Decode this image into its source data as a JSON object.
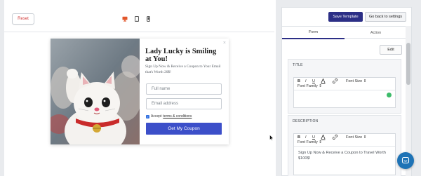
{
  "toolbar": {
    "reset_label": "Reset",
    "device_icons": [
      "desktop-icon",
      "tablet-icon",
      "mobile-icon"
    ]
  },
  "popup": {
    "title": "Lady Lucky is Smiling at You!",
    "description": "Sign Up Now & Receive a Coupon to Your Email that's Worth 20$!",
    "fields": [
      {
        "placeholder": "Full name"
      },
      {
        "placeholder": "Email address"
      }
    ],
    "agree_prefix": "Accept",
    "agree_link": "terms & conditions",
    "button_label": "Get My Coupon",
    "close_symbol": "×",
    "image": "maneki-neko-cat-image"
  },
  "sidebar": {
    "save_label": "Save Template",
    "back_label": "Go back to settings",
    "tabs": [
      {
        "label": "Form",
        "active": true
      },
      {
        "label": "Action",
        "active": false
      }
    ],
    "edit_label": "Edit",
    "sections": [
      {
        "label": "TITLE",
        "value": ""
      },
      {
        "label": "DESCRIPTION",
        "value": "Sign Up Now & Receive a Coupon to Travel Worth $100$!"
      }
    ],
    "editor_tools": {
      "bold": "B",
      "italic": "I",
      "underline": "U",
      "font_size": "Font Size",
      "font_family": "Font Family",
      "arrows": "⇕"
    }
  },
  "colors": {
    "primary": "#2c2f86",
    "coupon_button": "#3c4fc9",
    "reset_text": "#d23a3a",
    "device_active": "#e2572b",
    "chat": "#1e73b6"
  }
}
